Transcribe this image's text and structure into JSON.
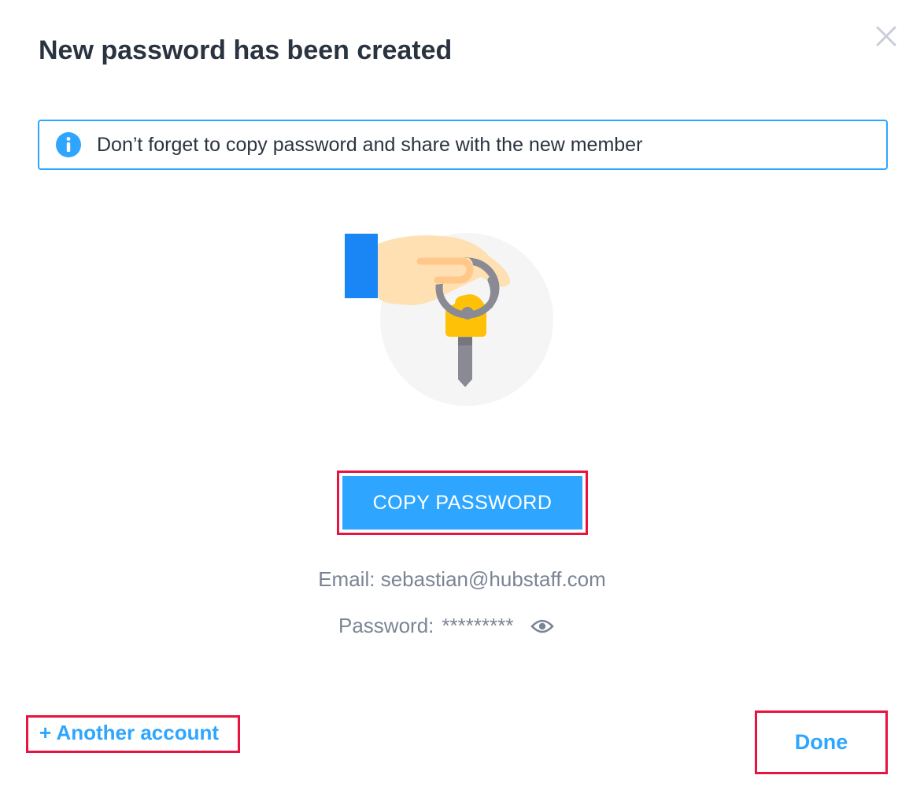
{
  "dialog": {
    "title": "New password has been created",
    "close_icon": "close-icon"
  },
  "info": {
    "icon": "info-icon",
    "text": "Don’t forget to copy password and share with the new member"
  },
  "illustration": {
    "icon": "hand-holding-key-illustration"
  },
  "actions": {
    "copy_label": "COPY PASSWORD",
    "another_label": "+ Another account",
    "done_label": "Done"
  },
  "credentials": {
    "email_label": "Email:",
    "email_value": "sebastian@hubstaff.com",
    "password_label": "Password:",
    "password_value": "*********",
    "reveal_icon": "eye-icon"
  },
  "colors": {
    "accent": "#2ea6ff",
    "title_text": "#2a3340",
    "muted_text": "#7a8594",
    "highlight_frame": "#e8133f",
    "cuff": "#1a86f5",
    "key_head": "#ffc107",
    "key_shaft": "#8a8a94",
    "skin": "#ffe0b2",
    "circle_bg": "#f5f5f5"
  }
}
